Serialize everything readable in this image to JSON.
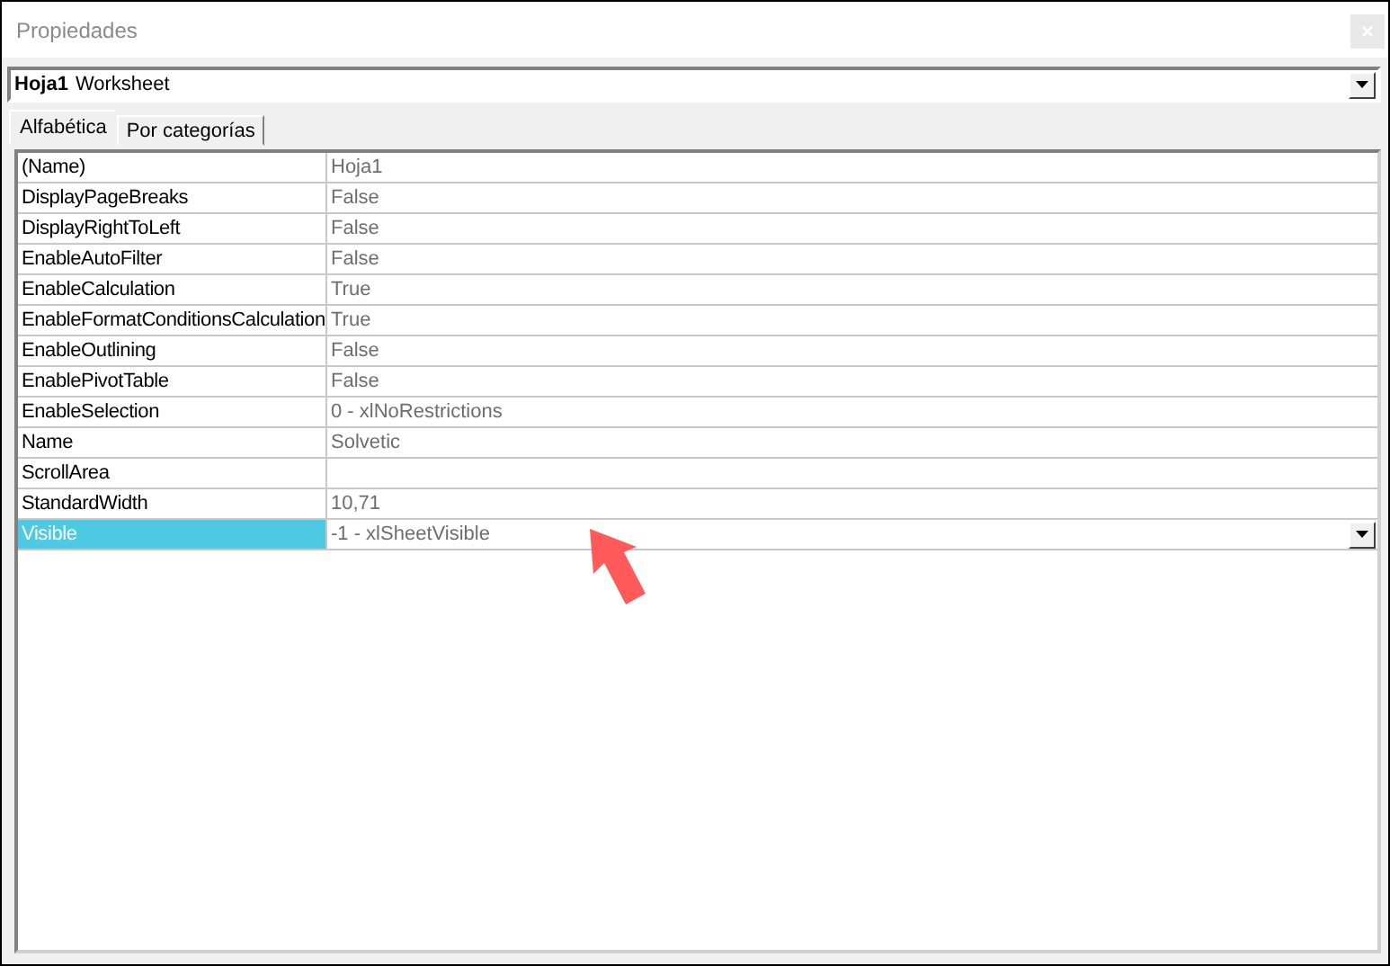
{
  "window": {
    "title": "Propiedades"
  },
  "object_selector": {
    "name": "Hoja1",
    "type": "Worksheet"
  },
  "tabs": [
    {
      "label": "Alfabética",
      "selected": true
    },
    {
      "label": "Por categorías",
      "selected": false
    }
  ],
  "properties": [
    {
      "name": "(Name)",
      "value": "Hoja1",
      "selected": false
    },
    {
      "name": "DisplayPageBreaks",
      "value": "False",
      "selected": false
    },
    {
      "name": "DisplayRightToLeft",
      "value": "False",
      "selected": false
    },
    {
      "name": "EnableAutoFilter",
      "value": "False",
      "selected": false
    },
    {
      "name": "EnableCalculation",
      "value": "True",
      "selected": false
    },
    {
      "name": "EnableFormatConditionsCalculation",
      "value": "True",
      "selected": false
    },
    {
      "name": "EnableOutlining",
      "value": "False",
      "selected": false
    },
    {
      "name": "EnablePivotTable",
      "value": "False",
      "selected": false
    },
    {
      "name": "EnableSelection",
      "value": "0 - xlNoRestrictions",
      "selected": false
    },
    {
      "name": "Name",
      "value": "Solvetic",
      "selected": false
    },
    {
      "name": "ScrollArea",
      "selected": false
    },
    {
      "name": "StandardWidth",
      "value": "10,71",
      "selected": false
    },
    {
      "name": "Visible",
      "value": "-1 - xlSheetVisible",
      "selected": true
    }
  ]
}
